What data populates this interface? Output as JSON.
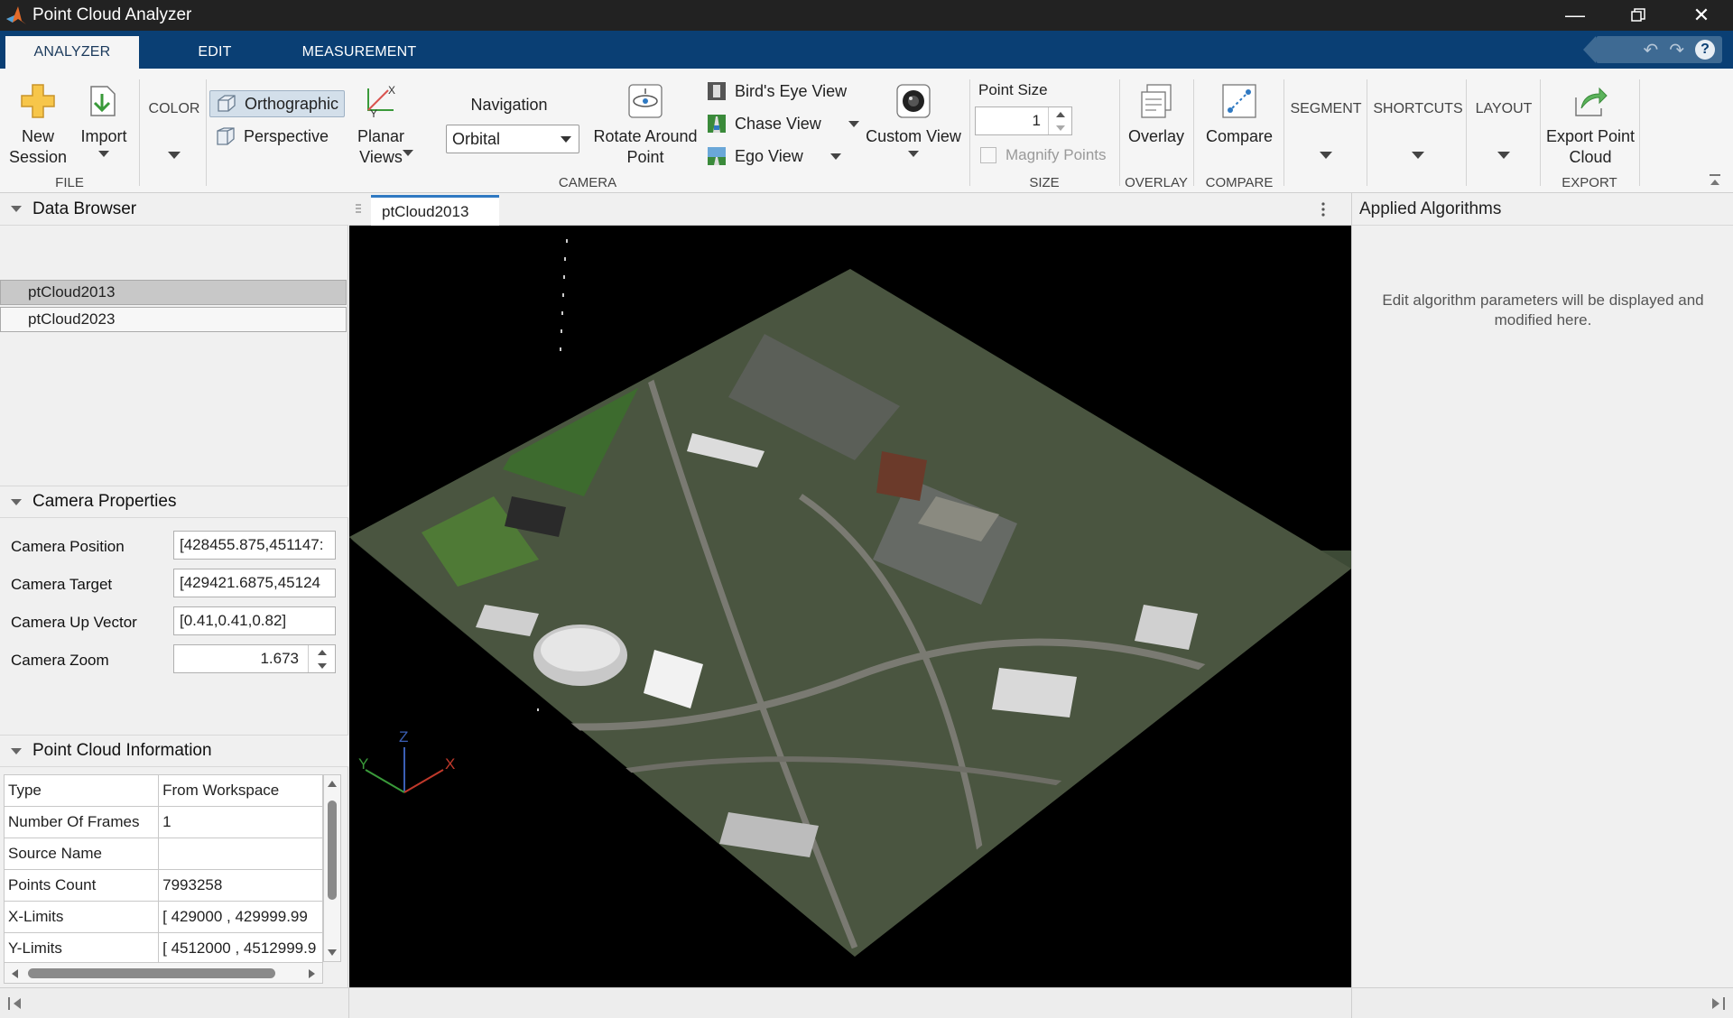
{
  "window": {
    "title": "Point Cloud Analyzer"
  },
  "tabs": [
    {
      "label": "ANALYZER",
      "active": true
    },
    {
      "label": "EDIT",
      "active": false
    },
    {
      "label": "MEASUREMENT",
      "active": false
    }
  ],
  "toolstrip": {
    "file": {
      "label": "FILE",
      "new_session": "New Session",
      "import": "Import"
    },
    "color": {
      "label": "COLOR"
    },
    "camera": {
      "label": "CAMERA",
      "orthographic": "Orthographic",
      "perspective": "Perspective",
      "planar_views": "Planar Views",
      "navigation_label": "Navigation",
      "navigation_value": "Orbital",
      "rotate_around_point": "Rotate Around Point",
      "birds_eye_view": "Bird's Eye View",
      "chase_view": "Chase View",
      "ego_view": "Ego View",
      "custom_view": "Custom View"
    },
    "size": {
      "label": "SIZE",
      "point_size_label": "Point Size",
      "point_size_value": "1",
      "magnify_points": "Magnify Points"
    },
    "overlay": {
      "label": "OVERLAY",
      "button": "Overlay"
    },
    "compare": {
      "label": "COMPARE",
      "button": "Compare"
    },
    "segment": {
      "label": "SEGMENT"
    },
    "shortcuts": {
      "label": "SHORTCUTS"
    },
    "layout": {
      "label": "LAYOUT"
    },
    "export": {
      "label": "EXPORT",
      "button": "Export Point Cloud"
    }
  },
  "data_browser": {
    "title": "Data Browser",
    "items": [
      "ptCloud2013",
      "ptCloud2023"
    ]
  },
  "camera_properties": {
    "title": "Camera Properties",
    "position_label": "Camera Position",
    "position_value": "[428455.875,451147:",
    "target_label": "Camera Target",
    "target_value": "[429421.6875,45124",
    "up_label": "Camera Up Vector",
    "up_value": "[0.41,0.41,0.82]",
    "zoom_label": "Camera Zoom",
    "zoom_value": "1.673"
  },
  "point_cloud_info": {
    "title": "Point Cloud Information",
    "rows": [
      {
        "key": "Type",
        "value": "From Workspace"
      },
      {
        "key": "Number Of Frames",
        "value": "1"
      },
      {
        "key": "Source Name",
        "value": ""
      },
      {
        "key": "Points Count",
        "value": "7993258"
      },
      {
        "key": "X-Limits",
        "value": "[ 429000 , 429999.99"
      },
      {
        "key": "Y-Limits",
        "value": "[ 4512000 , 4512999.9"
      }
    ]
  },
  "document": {
    "tab": "ptCloud2013"
  },
  "axes": {
    "x": "X",
    "y": "Y",
    "z": "Z"
  },
  "applied_algorithms": {
    "title": "Applied Algorithms",
    "message": "Edit algorithm parameters will be displayed and modified here."
  },
  "colors": {
    "tab_bar": "#0a3f74",
    "title_bar": "#222222",
    "accent": "#2f79c2"
  }
}
